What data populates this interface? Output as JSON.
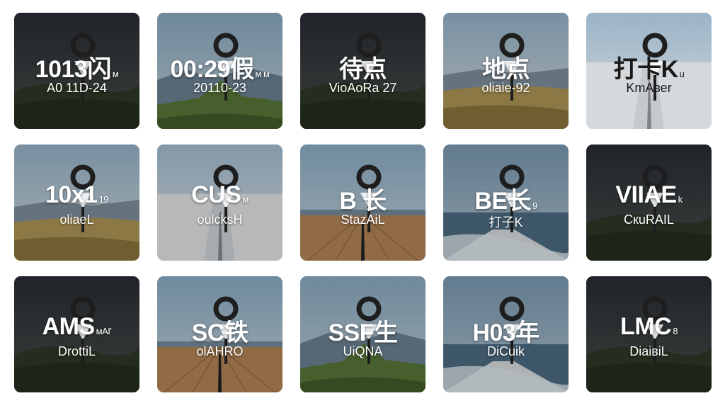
{
  "tiles": [
    {
      "title": "1013闪",
      "suffix": "м",
      "subtitle": "A0 11D-24",
      "scene": "dark-hill",
      "light": false
    },
    {
      "title": "00:29假",
      "suffix": "м м",
      "subtitle": "20110-23",
      "scene": "mountain-peak",
      "light": false
    },
    {
      "title": "待点",
      "suffix": "",
      "subtitle": "VioAoRa 27",
      "scene": "dark-hill",
      "light": false
    },
    {
      "title": "地点",
      "suffix": "",
      "subtitle": "oliaie-92",
      "scene": "grass-field",
      "light": false
    },
    {
      "title": "打卡K",
      "suffix": "u",
      "subtitle": "KmAвеr",
      "scene": "snow-road",
      "light": true
    },
    {
      "title": "10x1",
      "suffix": "19",
      "subtitle": "oliaeL",
      "scene": "grass-field",
      "light": false
    },
    {
      "title": "CUS",
      "suffix": "м",
      "subtitle": "oulcksH",
      "scene": "snow-road",
      "light": false
    },
    {
      "title": "B  长",
      "suffix": "",
      "subtitle": "StazAiL",
      "scene": "wood-pier",
      "light": false
    },
    {
      "title": "BE长",
      "suffix": "9",
      "subtitle": "打子K",
      "scene": "sea-pier",
      "light": false
    },
    {
      "title": "VIIAE",
      "suffix": "k",
      "subtitle": "CкuRAIL",
      "scene": "dark-hill",
      "light": false
    },
    {
      "title": "AMS",
      "suffix": "мАІ'",
      "subtitle": "DrottiL",
      "scene": "dark-hill",
      "light": false
    },
    {
      "title": "SC铁",
      "suffix": "",
      "subtitle": "olAHRO",
      "scene": "wood-pier",
      "light": false
    },
    {
      "title": "SSF生",
      "suffix": "",
      "subtitle": "UiQNA",
      "scene": "mountain-peak",
      "light": false
    },
    {
      "title": "H03年",
      "suffix": "",
      "subtitle": "DiCuik",
      "scene": "sea-pier",
      "light": false
    },
    {
      "title": "LMC",
      "suffix": "8",
      "subtitle": "DiaiвiL",
      "scene": "dark-hill",
      "light": false
    }
  ]
}
